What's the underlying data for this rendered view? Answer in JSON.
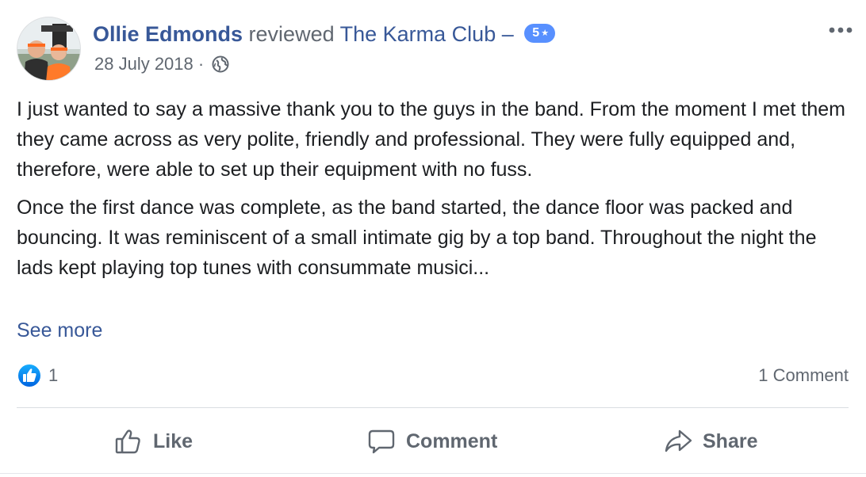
{
  "review": {
    "author": "Ollie Edmonds",
    "verb": "reviewed",
    "page": "The Karma Club",
    "dash": "–",
    "rating": "5",
    "date": "28 July 2018",
    "separator": "·",
    "audience_icon": "globe-icon",
    "menu_icon": "more-options-icon"
  },
  "body": {
    "paragraph_1": "I just wanted to say a massive thank you to the guys in the band. From the moment I met them they came across as very polite, friendly and professional. They were fully equipped and, therefore, were able to set up their equipment with no fuss.",
    "paragraph_2": "Once the first dance was complete, as the band started, the dance floor was packed and bouncing. It was reminiscent of a small intimate gig by a top band. Throughout the night the lads kept playing top tunes with consummate musici...",
    "see_more": "See more"
  },
  "stats": {
    "reaction_icon": "like-reaction-icon",
    "like_count": "1",
    "comment_count": "1 Comment"
  },
  "actions": {
    "like": "Like",
    "comment": "Comment",
    "share": "Share"
  },
  "colors": {
    "link": "#385898",
    "secondary_text": "#606770",
    "rating_badge": "#5890ff",
    "like_badge": "#1877f2"
  }
}
